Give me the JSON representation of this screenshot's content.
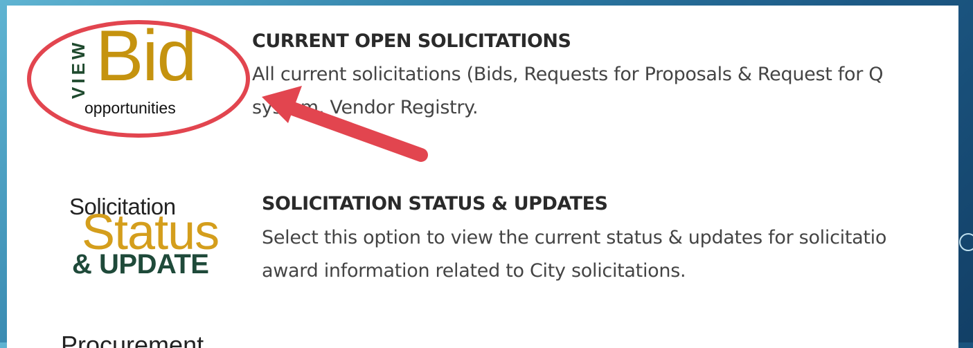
{
  "items": [
    {
      "logo": {
        "view": "VIEW",
        "bid": "Bid",
        "sub": "opportunities"
      },
      "title": "CURRENT OPEN SOLICITATIONS",
      "desc_line1": "All current solicitations (Bids, Requests for Proposals & Request for Q",
      "desc_line2": "system, Vendor Registry."
    },
    {
      "logo": {
        "line1": "Solicitation",
        "line2": "Status",
        "line3": "& UPDATE"
      },
      "title": "SOLICITATION STATUS & UPDATES",
      "desc_line1": "Select this option to view the current status & updates for solicitatio",
      "desc_line2": "award information related to City solicitations."
    }
  ],
  "partial_text": "Procurement",
  "colors": {
    "annotation": "#e2454f",
    "gold": "#c5930f",
    "green": "#1f4a2e"
  }
}
